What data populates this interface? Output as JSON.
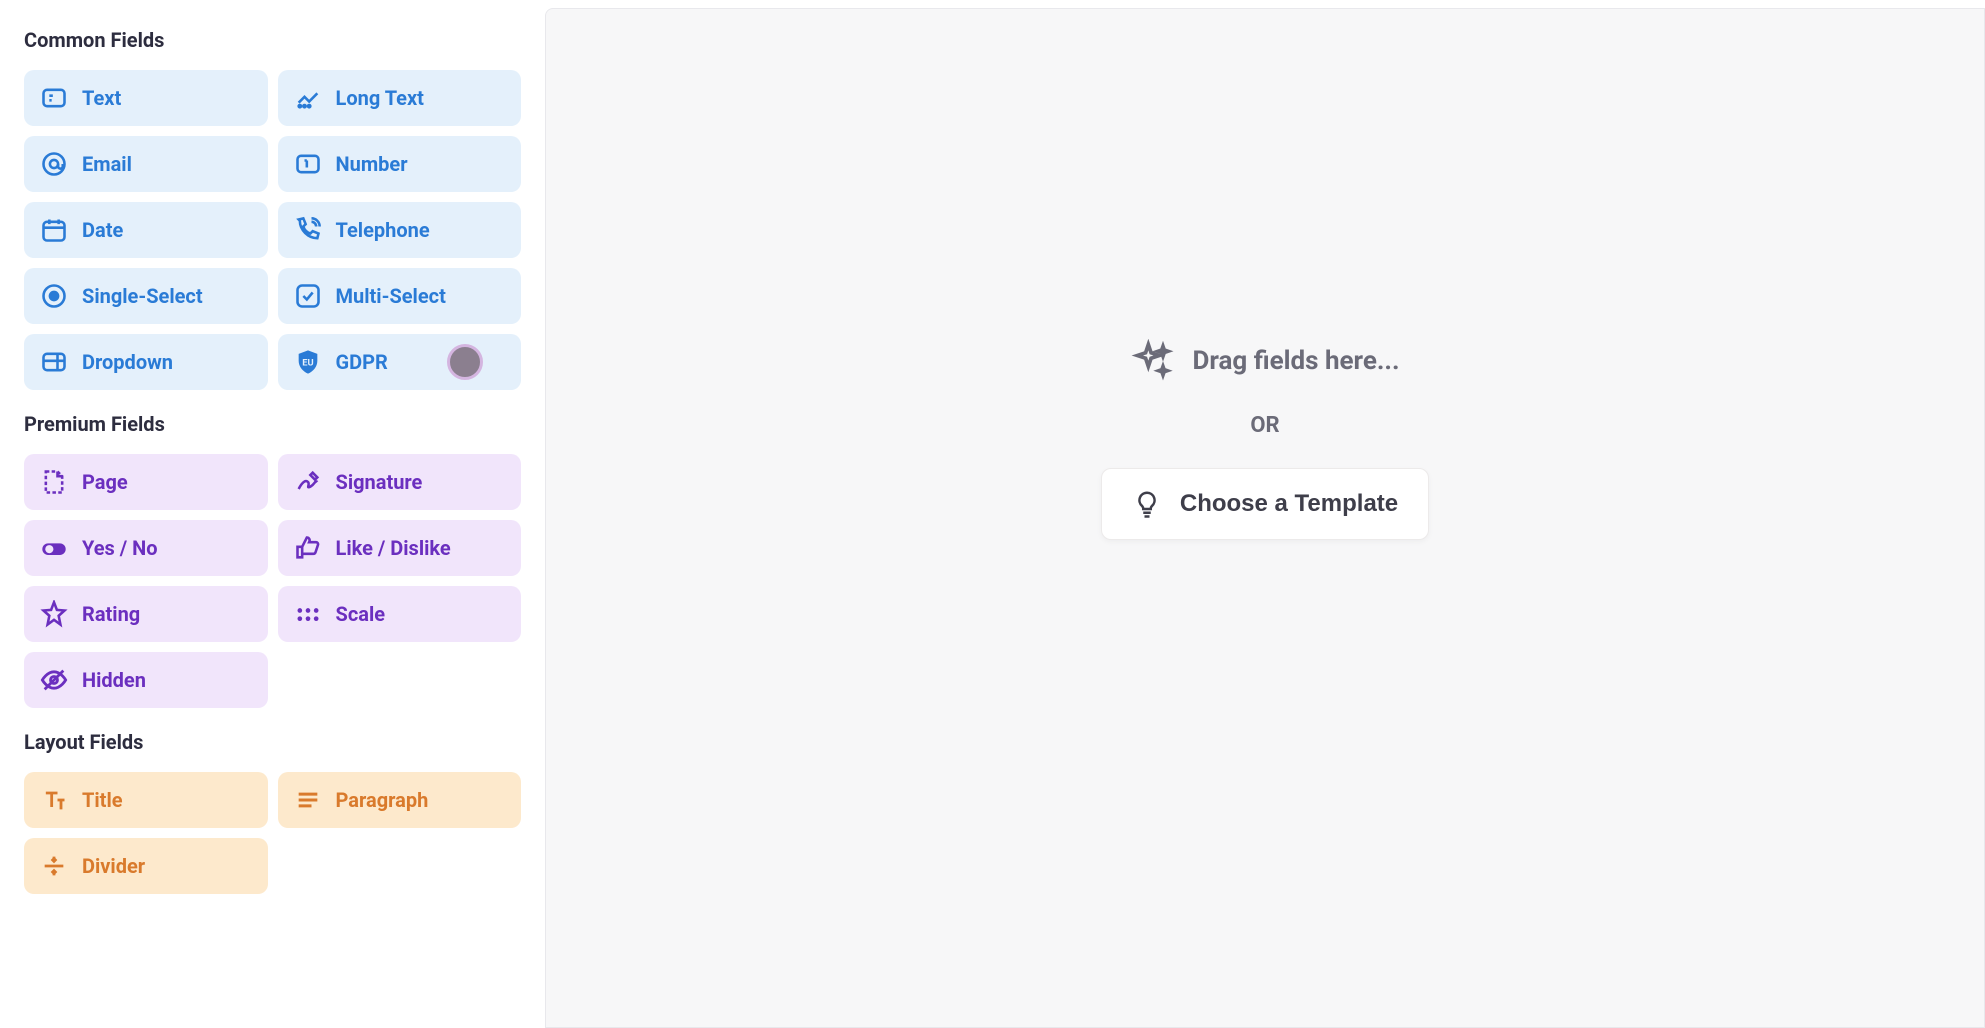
{
  "sidebar": {
    "sections": {
      "common": {
        "title": "Common Fields",
        "items": [
          {
            "label": "Text",
            "icon": "text"
          },
          {
            "label": "Long Text",
            "icon": "longtext"
          },
          {
            "label": "Email",
            "icon": "email"
          },
          {
            "label": "Number",
            "icon": "number"
          },
          {
            "label": "Date",
            "icon": "date"
          },
          {
            "label": "Telephone",
            "icon": "telephone"
          },
          {
            "label": "Single-Select",
            "icon": "radio"
          },
          {
            "label": "Multi-Select",
            "icon": "checkbox"
          },
          {
            "label": "Dropdown",
            "icon": "dropdown"
          },
          {
            "label": "GDPR",
            "icon": "gdpr"
          }
        ]
      },
      "premium": {
        "title": "Premium Fields",
        "items": [
          {
            "label": "Page",
            "icon": "page"
          },
          {
            "label": "Signature",
            "icon": "signature"
          },
          {
            "label": "Yes / No",
            "icon": "toggle"
          },
          {
            "label": "Like / Dislike",
            "icon": "thumb"
          },
          {
            "label": "Rating",
            "icon": "star"
          },
          {
            "label": "Scale",
            "icon": "scale"
          },
          {
            "label": "Hidden",
            "icon": "hidden"
          }
        ]
      },
      "layout": {
        "title": "Layout Fields",
        "items": [
          {
            "label": "Title",
            "icon": "title"
          },
          {
            "label": "Paragraph",
            "icon": "paragraph"
          },
          {
            "label": "Divider",
            "icon": "divider"
          }
        ]
      }
    }
  },
  "main": {
    "drag_prompt": "Drag fields here...",
    "or_text": "OR",
    "template_button": "Choose a Template"
  }
}
